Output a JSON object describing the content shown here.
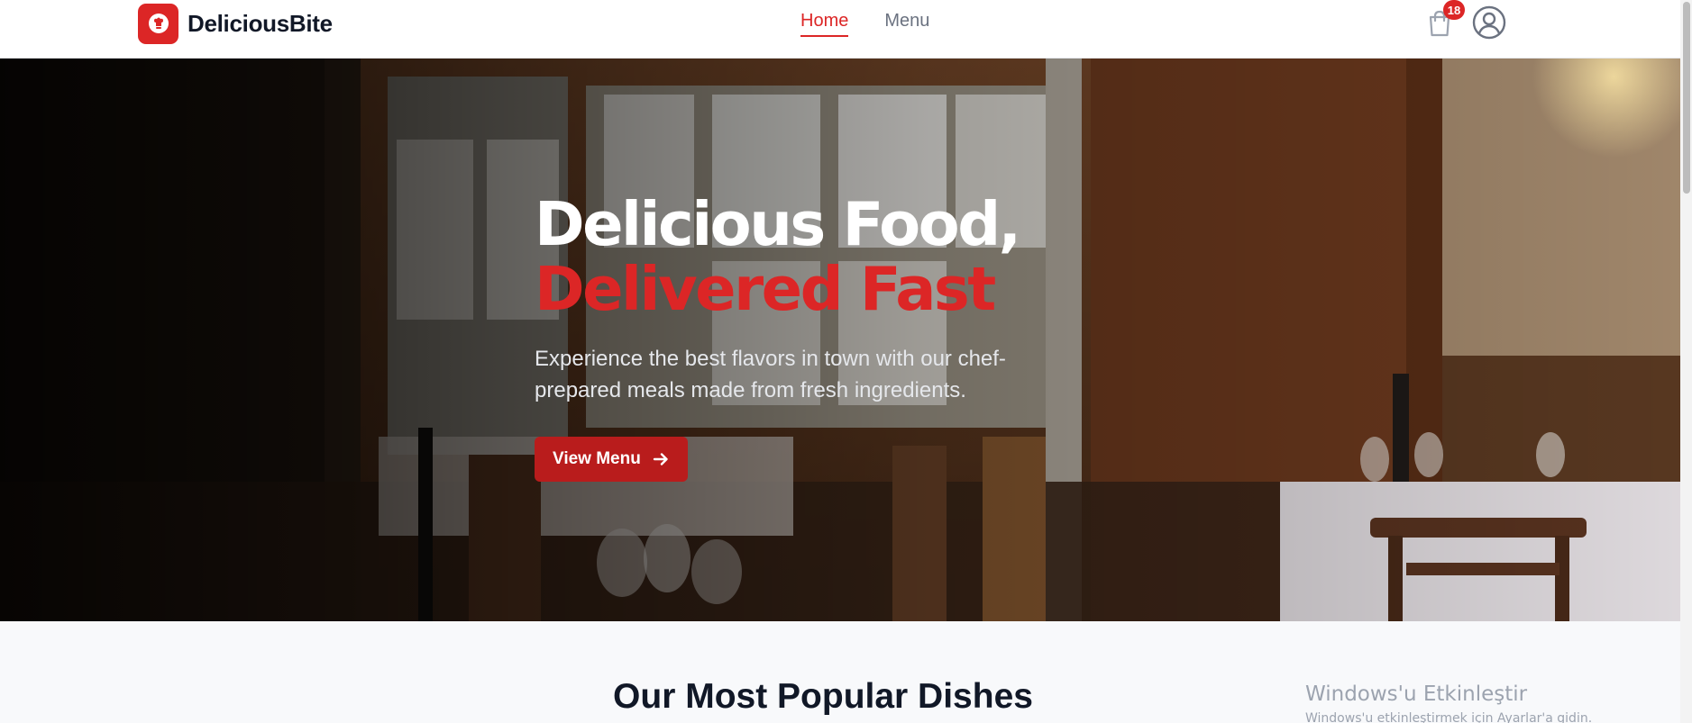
{
  "header": {
    "brand": "DeliciousBite",
    "nav": [
      {
        "label": "Home",
        "active": true
      },
      {
        "label": "Menu",
        "active": false
      }
    ],
    "cart_count": "18",
    "accent_color": "#dc2626"
  },
  "hero": {
    "title_line1": "Delicious Food,",
    "title_line2": "Delivered Fast",
    "subtitle": "Experience the best flavors in town with our chef-prepared meals made from fresh ingredients.",
    "cta_label": "View Menu",
    "cta_icon": "arrow-right-icon",
    "background": "restaurant-interior-photo"
  },
  "popular": {
    "title": "Our Most Popular Dishes"
  },
  "watermark": {
    "title": "Windows'u Etkinleştir",
    "subtitle": "Windows'u etkinleştirmek için Ayarlar'a gidin."
  },
  "icons": {
    "logo": "chef-hat-icon",
    "cart": "shopping-bag-icon",
    "user": "user-circle-icon"
  }
}
